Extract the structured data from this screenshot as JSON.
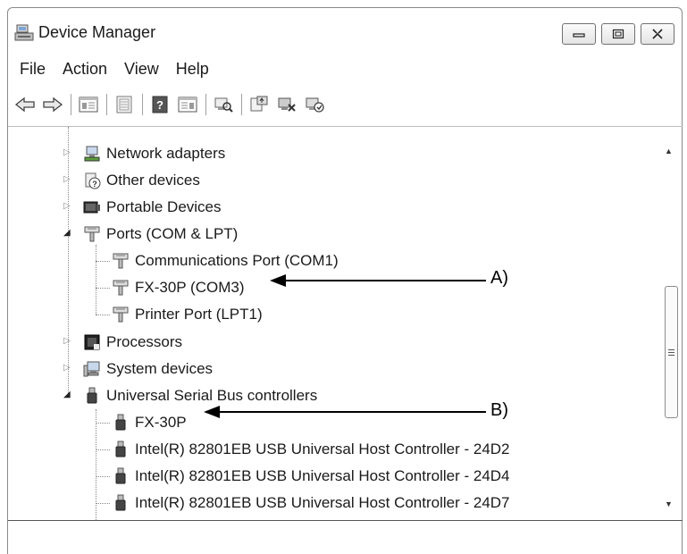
{
  "window": {
    "title": "Device Manager",
    "app_icon": "device-manager-icon",
    "buttons": {
      "minimize_icon": "minimize-icon",
      "maximize_icon": "maximize-icon",
      "close_icon": "close-icon"
    }
  },
  "menu": {
    "items": [
      "File",
      "Action",
      "View",
      "Help"
    ]
  },
  "toolbar": {
    "icons": [
      "back-arrow-icon",
      "forward-arrow-icon",
      "show-hide-tree-icon",
      "properties-icon",
      "help-icon",
      "action-pane-icon",
      "scan-hardware-icon",
      "update-driver-icon",
      "uninstall-icon",
      "enable-device-icon"
    ]
  },
  "tree": {
    "categories": {
      "network_adapters": "Network adapters",
      "other_devices": "Other devices",
      "portable_devices": "Portable Devices",
      "ports": "Ports (COM & LPT)",
      "processors": "Processors",
      "system_devices": "System devices",
      "usb_controllers": "Universal Serial Bus controllers"
    },
    "ports_children": [
      "Communications Port (COM1)",
      "FX-30P (COM3)",
      "Printer Port (LPT1)"
    ],
    "usb_children": [
      "FX-30P",
      "Intel(R) 82801EB USB Universal Host Controller - 24D2",
      "Intel(R) 82801EB USB Universal Host Controller - 24D4",
      "Intel(R) 82801EB USB Universal Host Controller - 24D7"
    ]
  },
  "callouts": {
    "a": "A)",
    "b": "B)"
  },
  "colors": {
    "window_border": "#8a8a8a",
    "tree_line": "#888888",
    "callout": "#000000"
  }
}
